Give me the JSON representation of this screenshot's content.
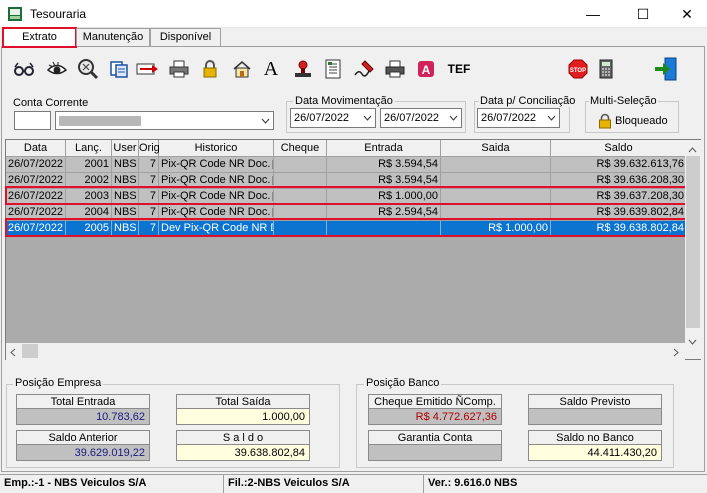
{
  "window": {
    "title": "Tesouraria"
  },
  "tabs": [
    {
      "label": "Extrato"
    },
    {
      "label": "Manutenção"
    },
    {
      "label": "Disponível"
    }
  ],
  "toolbar": {
    "tef_label": "TEF"
  },
  "conta": {
    "label": "Conta Corrente",
    "code": "",
    "name": ""
  },
  "movimentacao": {
    "label": "Data Movimentação",
    "from": "26/07/2022",
    "to": "26/07/2022"
  },
  "conciliacao": {
    "label": "Data p/ Conciliação",
    "date": "26/07/2022"
  },
  "multi": {
    "label": "Multi-Seleção",
    "button": "Bloqueado"
  },
  "grid": {
    "columns": [
      "Data",
      "Lanç.",
      "User",
      "Orig",
      "Historico",
      "Cheque",
      "Entrada",
      "Saida",
      "Saldo"
    ],
    "rows": [
      {
        "data": "26/07/2022",
        "lanc": "2001",
        "user": "NBS",
        "orig": "7",
        "hist": "Pix-QR Code NR Doc.",
        "cheque": "",
        "entrada": "R$ 3.594,54",
        "saida": "",
        "saldo": "R$ 39.632.613,76"
      },
      {
        "data": "26/07/2022",
        "lanc": "2002",
        "user": "NBS",
        "orig": "7",
        "hist": "Pix-QR Code NR Doc.",
        "cheque": "",
        "entrada": "R$ 3.594,54",
        "saida": "",
        "saldo": "R$ 39.636.208,30"
      },
      {
        "data": "26/07/2022",
        "lanc": "2003",
        "user": "NBS",
        "orig": "7",
        "hist": "Pix-QR Code NR Doc.",
        "cheque": "",
        "entrada": "R$ 1.000,00",
        "saida": "",
        "saldo": "R$ 39.637.208,30"
      },
      {
        "data": "26/07/2022",
        "lanc": "2004",
        "user": "NBS",
        "orig": "7",
        "hist": "Pix-QR Code NR Doc.",
        "cheque": "",
        "entrada": "R$ 2.594,54",
        "saida": "",
        "saldo": "R$ 39.639.802,84"
      },
      {
        "data": "26/07/2022",
        "lanc": "2005",
        "user": "NBS",
        "orig": "7",
        "hist": "Dev Pix-QR Code NR Doc",
        "cheque": "",
        "entrada": "",
        "saida": "R$ 1.000,00",
        "saldo": "R$ 39.638.802,84"
      }
    ]
  },
  "empresa": {
    "label": "Posição Empresa",
    "total_entrada_label": "Total Entrada",
    "total_entrada": "10.783,62",
    "total_saida_label": "Total Saída",
    "total_saida": "1.000,00",
    "saldo_anterior_label": "Saldo Anterior",
    "saldo_anterior": "39.629.019,22",
    "saldo_label": "S a l d o",
    "saldo": "39.638.802,84"
  },
  "banco": {
    "label": "Posição Banco",
    "cheque_label": "Cheque Emitido ÑComp.",
    "cheque": "R$ 4.772.627,36",
    "saldo_previsto_label": "Saldo Previsto",
    "saldo_previsto": "",
    "garantia_label": "Garantia Conta",
    "garantia": "",
    "saldo_banco_label": "Saldo no Banco",
    "saldo_banco": "44.411.430,20"
  },
  "status": {
    "emp": "Emp.:-1 - NBS Veiculos S/A",
    "fil": "Fil.:2-NBS Veiculos S/A",
    "ver": "Ver.: 9.616.0  NBS"
  }
}
